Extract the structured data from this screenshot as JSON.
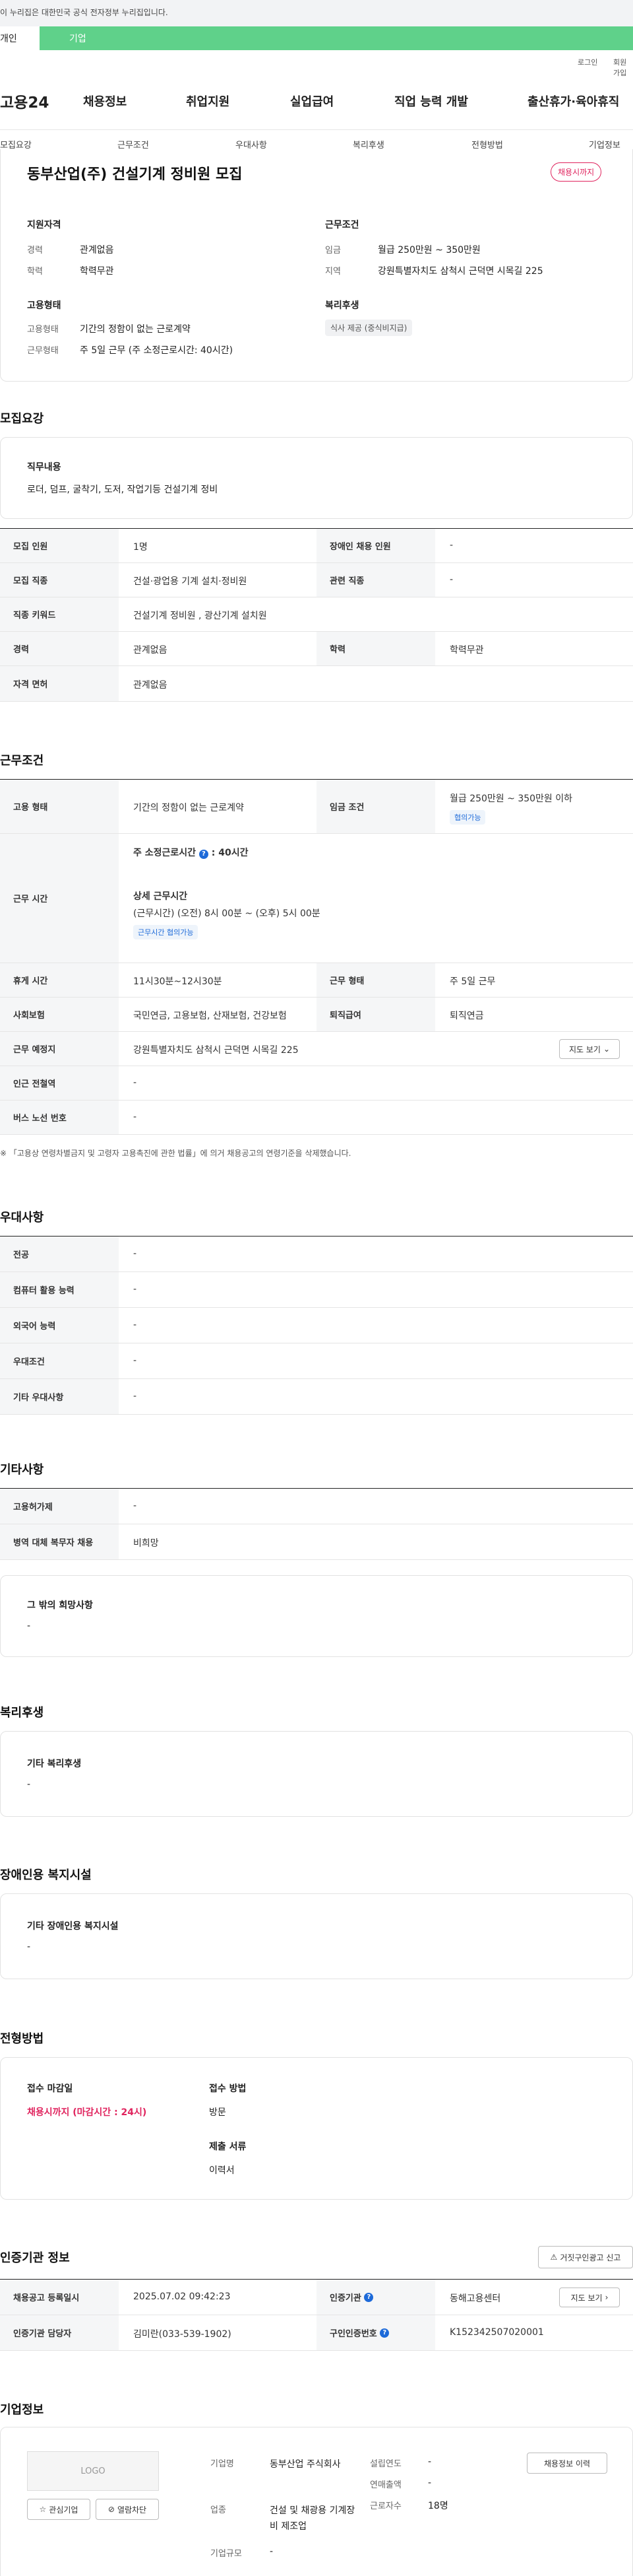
{
  "gov_bar": {
    "text": "이 누리집은 대한민국 공식 전자정부 누리집입니다."
  },
  "site_tabs": {
    "individual": "개인",
    "company": "기업"
  },
  "util": {
    "login": "로그인",
    "signup": "회원가입"
  },
  "logo": "고용24",
  "gnb": [
    "채용정보",
    "취업지원",
    "실업급여",
    "직업 능력 개발",
    "출산휴가·육아휴직"
  ],
  "subnav": [
    "모집요강",
    "근무조건",
    "우대사항",
    "복리후생",
    "전형방법",
    "기업정보"
  ],
  "summary": {
    "title": "동부산업(주) 건설기계 정비원 모집",
    "badge": "채용시까지",
    "qual_title": "지원자격",
    "qual": [
      {
        "label": "경력",
        "value": "관계없음"
      },
      {
        "label": "학력",
        "value": "학력무관"
      }
    ],
    "cond_title": "근무조건",
    "cond": [
      {
        "label": "임금",
        "value": "월급 250만원 ~ 350만원"
      },
      {
        "label": "지역",
        "value": "강원특별자치도 삼척시 근덕면 시목길 225"
      }
    ],
    "emp_title": "고용형태",
    "emp": [
      {
        "label": "고용형태",
        "value": "기간의 정함이 없는 근로계약"
      },
      {
        "label": "근무형태",
        "value": "주 5일 근무 (주 소정근로시간: 40시간)"
      }
    ],
    "welfare_title": "복리후생",
    "welfare_chip": "식사 제공 (중식비지급)"
  },
  "recruit": {
    "section_title": "모집요강",
    "duty_title": "직무내용",
    "duty_text": "로더, 덤프, 굴착기, 도저, 작업기등 건설기계 정비",
    "rows": {
      "headcount_label": "모집 인원",
      "headcount": "1명",
      "disabled_label": "장애인 채용 인원",
      "disabled": "-",
      "job_label": "모집 직종",
      "job": "건설·광업용 기계 설치·정비원",
      "related_label": "관련 직종",
      "related": "-",
      "keyword_label": "직종 키워드",
      "keyword": "건설기계 정비원 , 광산기계 설치원",
      "career_label": "경력",
      "career": "관계없음",
      "edu_label": "학력",
      "edu": "학력무관",
      "license_label": "자격 면허",
      "license": "관계없음"
    }
  },
  "work": {
    "section_title": "근무조건",
    "emp_label": "고용 형태",
    "emp": "기간의 정함이 없는 근로계약",
    "wage_label": "임금 조건",
    "wage": "월급 250만원 ~ 350만원 이하",
    "wage_chip": "협의가능",
    "hours_label": "근무 시간",
    "hours_weekly": "주 소정근로시간",
    "hours_weekly_value": ": 40시간",
    "hours_detail_title": "상세 근무시간",
    "hours_detail": "(근무시간) (오전) 8시 00분 ~ (오후) 5시 00분",
    "hours_chip": "근무시간 협의가능",
    "break_label": "휴게 시간",
    "break": "11시30분~12시30분",
    "type_label": "근무 형태",
    "type": "주 5일 근무",
    "insurance_label": "사회보험",
    "insurance": "국민연금, 고용보험, 산재보험, 건강보험",
    "retire_label": "퇴직급여",
    "retire": "퇴직연금",
    "place_label": "근무 예정지",
    "place": "강원특별자치도 삼척시 근덕면 시목길 225",
    "map_btn": "지도 보기",
    "subway_label": "인근 전철역",
    "subway": "-",
    "bus_label": "버스 노선 번호",
    "bus": "-",
    "note": "※ 「고용상 연령차별금지 및 고령자 고용촉진에 관한 법률」에 의거 채용공고의 연령기준을 삭제했습니다."
  },
  "pref": {
    "section_title": "우대사항",
    "rows": [
      {
        "label": "전공",
        "value": "-"
      },
      {
        "label": "컴퓨터 활용 능력",
        "value": "-"
      },
      {
        "label": "외국어 능력",
        "value": "-"
      },
      {
        "label": "우대조건",
        "value": "-"
      },
      {
        "label": "기타 우대사항",
        "value": "-"
      }
    ]
  },
  "etc": {
    "section_title": "기타사항",
    "rows": [
      {
        "label": "고용허가제",
        "value": "-"
      },
      {
        "label": "병역 대체 복무자 채용",
        "value": "비희망"
      }
    ],
    "other_title": "그 밖의 희망사항",
    "other_value": "-"
  },
  "benefits": {
    "section_title": "복리후생",
    "box_title": "기타 복리후생",
    "box_value": "-"
  },
  "disabled_fac": {
    "section_title": "장애인용 복지시설",
    "box_title": "기타 장애인용 복지시설",
    "box_value": "-"
  },
  "selection": {
    "section_title": "전형방법",
    "deadline_title": "접수 마감일",
    "deadline_value": "채용시까지 (마감시간 : 24시)",
    "method_title": "접수 방법",
    "method_value": "방문",
    "docs_title": "제출 서류",
    "docs_value": "이력서"
  },
  "cert": {
    "section_title": "인증기관 정보",
    "report_btn": "거짓구인광고 신고",
    "reg_label": "채용공고 등록일시",
    "reg": "2025.07.02 09:42:23",
    "org_label": "인증기관",
    "org": "동해고용센터",
    "map_btn": "지도 보기",
    "manager_label": "인증기관 담당자",
    "manager": "김미란(033-539-1902)",
    "no_label": "구인인증번호",
    "no": "K152342507020001"
  },
  "company": {
    "section_title": "기업정보",
    "logo_text": "LOGO",
    "fav_btn": "관심기업",
    "block_btn": "열람차단",
    "name_label": "기업명",
    "name": "동부산업 주식회사",
    "industry_label": "업종",
    "industry": "건설 및 채광용 기계장비 제조업",
    "size_label": "기업규모",
    "size": "-",
    "year_label": "설립연도",
    "year": "-",
    "sales_label": "연매출액",
    "sales": "-",
    "employees_label": "근로자수",
    "employees": "18명",
    "history_btn": "채용정보 이력"
  }
}
